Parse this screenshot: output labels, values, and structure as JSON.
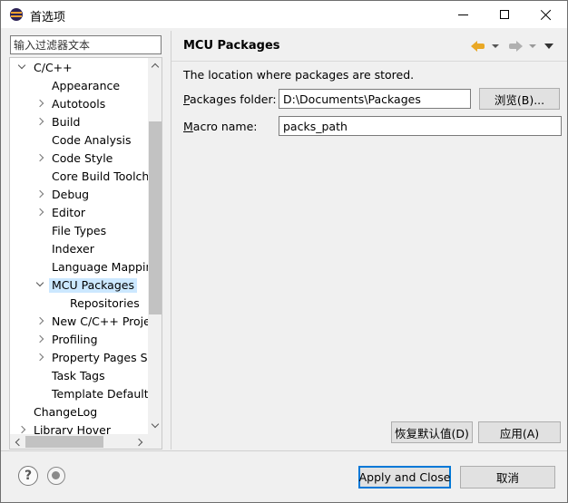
{
  "window": {
    "title": "首选项"
  },
  "filter": {
    "placeholder": "输入过滤器文本"
  },
  "tree": {
    "items": [
      {
        "label": "C/C++",
        "level": 0,
        "expander": "open"
      },
      {
        "label": "Appearance",
        "level": 1,
        "expander": "none"
      },
      {
        "label": "Autotools",
        "level": 1,
        "expander": "closed"
      },
      {
        "label": "Build",
        "level": 1,
        "expander": "closed"
      },
      {
        "label": "Code Analysis",
        "level": 1,
        "expander": "none"
      },
      {
        "label": "Code Style",
        "level": 1,
        "expander": "closed"
      },
      {
        "label": "Core Build Toolchains",
        "level": 1,
        "expander": "none"
      },
      {
        "label": "Debug",
        "level": 1,
        "expander": "closed"
      },
      {
        "label": "Editor",
        "level": 1,
        "expander": "closed"
      },
      {
        "label": "File Types",
        "level": 1,
        "expander": "none"
      },
      {
        "label": "Indexer",
        "level": 1,
        "expander": "none"
      },
      {
        "label": "Language Mappings",
        "level": 1,
        "expander": "none"
      },
      {
        "label": "MCU Packages",
        "level": 1,
        "expander": "open",
        "selected": true
      },
      {
        "label": "Repositories",
        "level": 2,
        "expander": "none"
      },
      {
        "label": "New C/C++ Project Wizard",
        "level": 1,
        "expander": "closed"
      },
      {
        "label": "Profiling",
        "level": 1,
        "expander": "closed"
      },
      {
        "label": "Property Pages Settings",
        "level": 1,
        "expander": "closed"
      },
      {
        "label": "Task Tags",
        "level": 1,
        "expander": "none"
      },
      {
        "label": "Template Default Values",
        "level": 1,
        "expander": "none"
      },
      {
        "label": "ChangeLog",
        "level": 0,
        "expander": "none"
      },
      {
        "label": "Library Hover",
        "level": 0,
        "expander": "closed"
      }
    ]
  },
  "page": {
    "title": "MCU Packages",
    "description": "The location where packages are stored.",
    "packages_folder": {
      "label_mnemonic": "P",
      "label_rest": "ackages folder:",
      "value": "D:\\Documents\\Packages"
    },
    "macro_name": {
      "label_mnemonic": "M",
      "label_rest": "acro name:",
      "value": "packs_path"
    },
    "browse_label": "浏览(B)..."
  },
  "buttons": {
    "restore_defaults": "恢复默认值(D)",
    "apply": "应用(A)",
    "apply_and_close": "Apply and Close",
    "cancel": "取消"
  },
  "icons": {
    "help": "?",
    "help_icon": "help-icon",
    "record_icon": "record-icon",
    "back_icon": "back-arrow-icon",
    "forward_icon": "forward-arrow-icon"
  },
  "colors": {
    "selection": "#cce8ff",
    "default_button_border": "#0078d7",
    "back_arrow": "#e9a825"
  }
}
